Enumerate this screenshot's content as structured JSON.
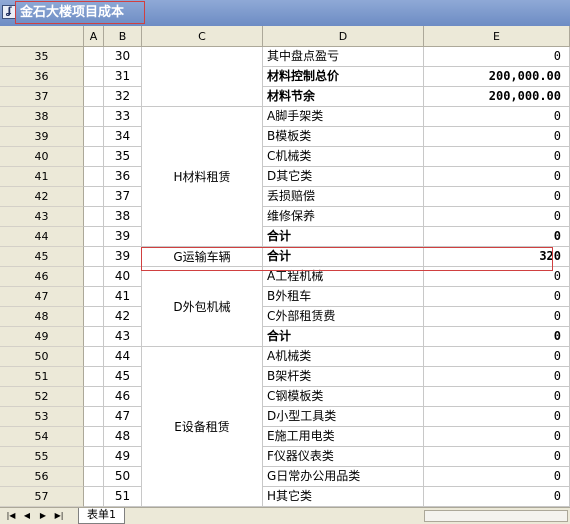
{
  "window": {
    "title": "金石大楼项目成本"
  },
  "columns": [
    "A",
    "B",
    "C",
    "D",
    "E"
  ],
  "rows": [
    {
      "row": "35",
      "b": "30",
      "d": "其中盘点盈亏",
      "e": "0",
      "bold": false
    },
    {
      "row": "36",
      "b": "31",
      "d": "材料控制总价",
      "e": "200,000.00",
      "bold": true
    },
    {
      "row": "37",
      "b": "32",
      "d": "材料节余",
      "e": "200,000.00",
      "bold": true
    },
    {
      "row": "38",
      "b": "33",
      "d": "A脚手架类",
      "e": "0",
      "bold": false
    },
    {
      "row": "39",
      "b": "34",
      "d": "B模板类",
      "e": "0",
      "bold": false
    },
    {
      "row": "40",
      "b": "35",
      "d": "C机械类",
      "e": "0",
      "bold": false
    },
    {
      "row": "41",
      "b": "36",
      "d": "D其它类",
      "e": "0",
      "bold": false
    },
    {
      "row": "42",
      "b": "37",
      "d": "丢损赔偿",
      "e": "0",
      "bold": false
    },
    {
      "row": "43",
      "b": "38",
      "d": "维修保养",
      "e": "0",
      "bold": false
    },
    {
      "row": "44",
      "b": "39",
      "d": "合计",
      "e": "0",
      "bold": true
    },
    {
      "row": "45",
      "b": "39",
      "d": "合计",
      "e": "320",
      "bold": true
    },
    {
      "row": "46",
      "b": "40",
      "d": "A工程机械",
      "e": "0",
      "bold": false
    },
    {
      "row": "47",
      "b": "41",
      "d": "B外租车",
      "e": "0",
      "bold": false
    },
    {
      "row": "48",
      "b": "42",
      "d": "C外部租赁费",
      "e": "0",
      "bold": false
    },
    {
      "row": "49",
      "b": "43",
      "d": "合计",
      "e": "0",
      "bold": true
    },
    {
      "row": "50",
      "b": "44",
      "d": "A机械类",
      "e": "0",
      "bold": false
    },
    {
      "row": "51",
      "b": "45",
      "d": "B架杆类",
      "e": "0",
      "bold": false
    },
    {
      "row": "52",
      "b": "46",
      "d": "C钢模板类",
      "e": "0",
      "bold": false
    },
    {
      "row": "53",
      "b": "47",
      "d": "D小型工具类",
      "e": "0",
      "bold": false
    },
    {
      "row": "54",
      "b": "48",
      "d": "E施工用电类",
      "e": "0",
      "bold": false
    },
    {
      "row": "55",
      "b": "49",
      "d": "F仪器仪表类",
      "e": "0",
      "bold": false
    },
    {
      "row": "56",
      "b": "50",
      "d": "G日常办公用品类",
      "e": "0",
      "bold": false
    },
    {
      "row": "57",
      "b": "51",
      "d": "H其它类",
      "e": "0",
      "bold": false
    }
  ],
  "groups": {
    "h_rental": "H材料租赁",
    "g_transport": "G运输车辆",
    "d_subcontract": "D外包机械",
    "e_equipment": "E设备租赁"
  },
  "sheet_tabs": [
    "表单1"
  ],
  "icons": {
    "app": "app-icon",
    "nav": [
      "first-sheet-icon",
      "prev-sheet-icon",
      "next-sheet-icon",
      "last-sheet-icon"
    ]
  }
}
